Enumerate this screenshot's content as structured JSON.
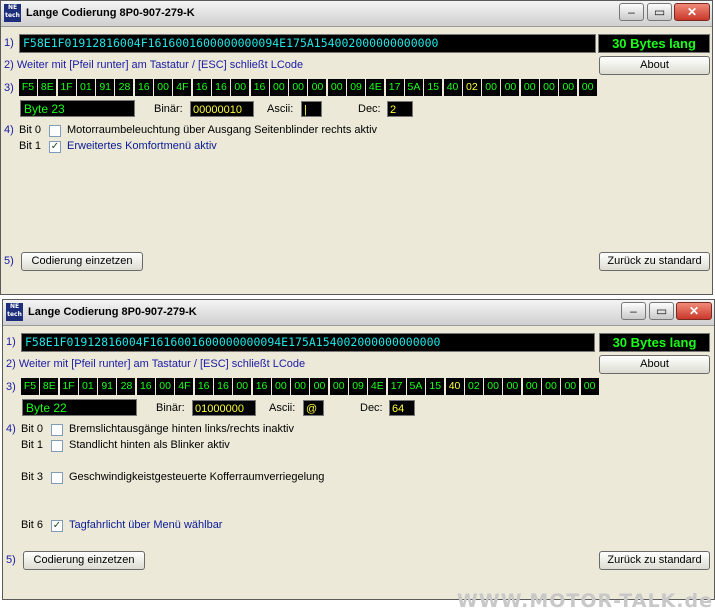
{
  "window1": {
    "title": "Lange Codierung 8P0-907-279-K",
    "icon_text": "NE tech",
    "row1_label": "1)",
    "code": "F58E1F01912816004F1616001600000000094E175A154002000000000000",
    "bytes_length": "30 Bytes lang",
    "row2_label": "2) Weiter mit [Pfeil runter] am Tastatur / [ESC] schließt LCode",
    "about_label": "About",
    "row3_label": "3)",
    "bytes": [
      "F5",
      "8E",
      "1F",
      "01",
      "91",
      "28",
      "16",
      "00",
      "4F",
      "16",
      "16",
      "00",
      "16",
      "00",
      "00",
      "00",
      "00",
      "09",
      "4E",
      "17",
      "5A",
      "15",
      "40",
      "02",
      "00",
      "00",
      "00",
      "00",
      "00",
      "00"
    ],
    "selected_index": 23,
    "byte_label": "Byte 23",
    "binar_label": "Binär:",
    "binar_value": "00000010",
    "ascii_label": "Ascii:",
    "ascii_value": "|",
    "dec_label": "Dec:",
    "dec_value": "2",
    "row4_label": "4)",
    "bits": [
      {
        "label": "Bit 0",
        "text": "Motorraumbeleuchtung über Ausgang Seitenblinder rechts aktiv",
        "checked": false
      },
      {
        "label": "Bit 1",
        "text": "Erweitertes Komfortmenü aktiv",
        "checked": true
      }
    ],
    "row5_label": "5)",
    "codierung_label": "Codierung einzetzen",
    "zuruck_label": "Zurück zu standard"
  },
  "window2": {
    "title": "Lange Codierung 8P0-907-279-K",
    "icon_text": "NE tech",
    "row1_label": "1)",
    "code": "F58E1F01912816004F1616001600000000094E175A154002000000000000",
    "bytes_length": "30 Bytes lang",
    "row2_label": "2) Weiter mit [Pfeil runter] am Tastatur / [ESC] schließt LCode",
    "about_label": "About",
    "row3_label": "3)",
    "bytes": [
      "F5",
      "8E",
      "1F",
      "01",
      "91",
      "28",
      "16",
      "00",
      "4F",
      "16",
      "16",
      "00",
      "16",
      "00",
      "00",
      "00",
      "00",
      "09",
      "4E",
      "17",
      "5A",
      "15",
      "40",
      "02",
      "00",
      "00",
      "00",
      "00",
      "00",
      "00"
    ],
    "selected_index": 22,
    "byte_label": "Byte 22",
    "binar_label": "Binär:",
    "binar_value": "01000000",
    "ascii_label": "Ascii:",
    "ascii_value": "@",
    "dec_label": "Dec:",
    "dec_value": "64",
    "row4_label": "4)",
    "bits": [
      {
        "label": "Bit 0",
        "text": "Bremslichtausgänge hinten links/rechts inaktiv",
        "checked": false
      },
      {
        "label": "Bit 1",
        "text": "Standlicht hinten als Blinker aktiv",
        "checked": false
      },
      {
        "label": "Bit 3",
        "text": "Geschwindigkeistgesteuerte Kofferraumverriegelung",
        "checked": false
      },
      {
        "label": "Bit 6",
        "text": "Tagfahrlicht über Menü wählbar",
        "checked": true
      }
    ],
    "row5_label": "5)",
    "codierung_label": "Codierung einzetzen",
    "zuruck_label": "Zurück zu standard"
  },
  "watermark": "WWW.MOTOR-TALK.de",
  "colors": {
    "window_bg": "#ece9d8",
    "label_blue": "#1a1aa6",
    "code_cyan": "#1ee6e6",
    "byte_green": "#1aff1a",
    "selected_yellow": "#ffff40",
    "bit_on_text": "#0a1a96"
  }
}
